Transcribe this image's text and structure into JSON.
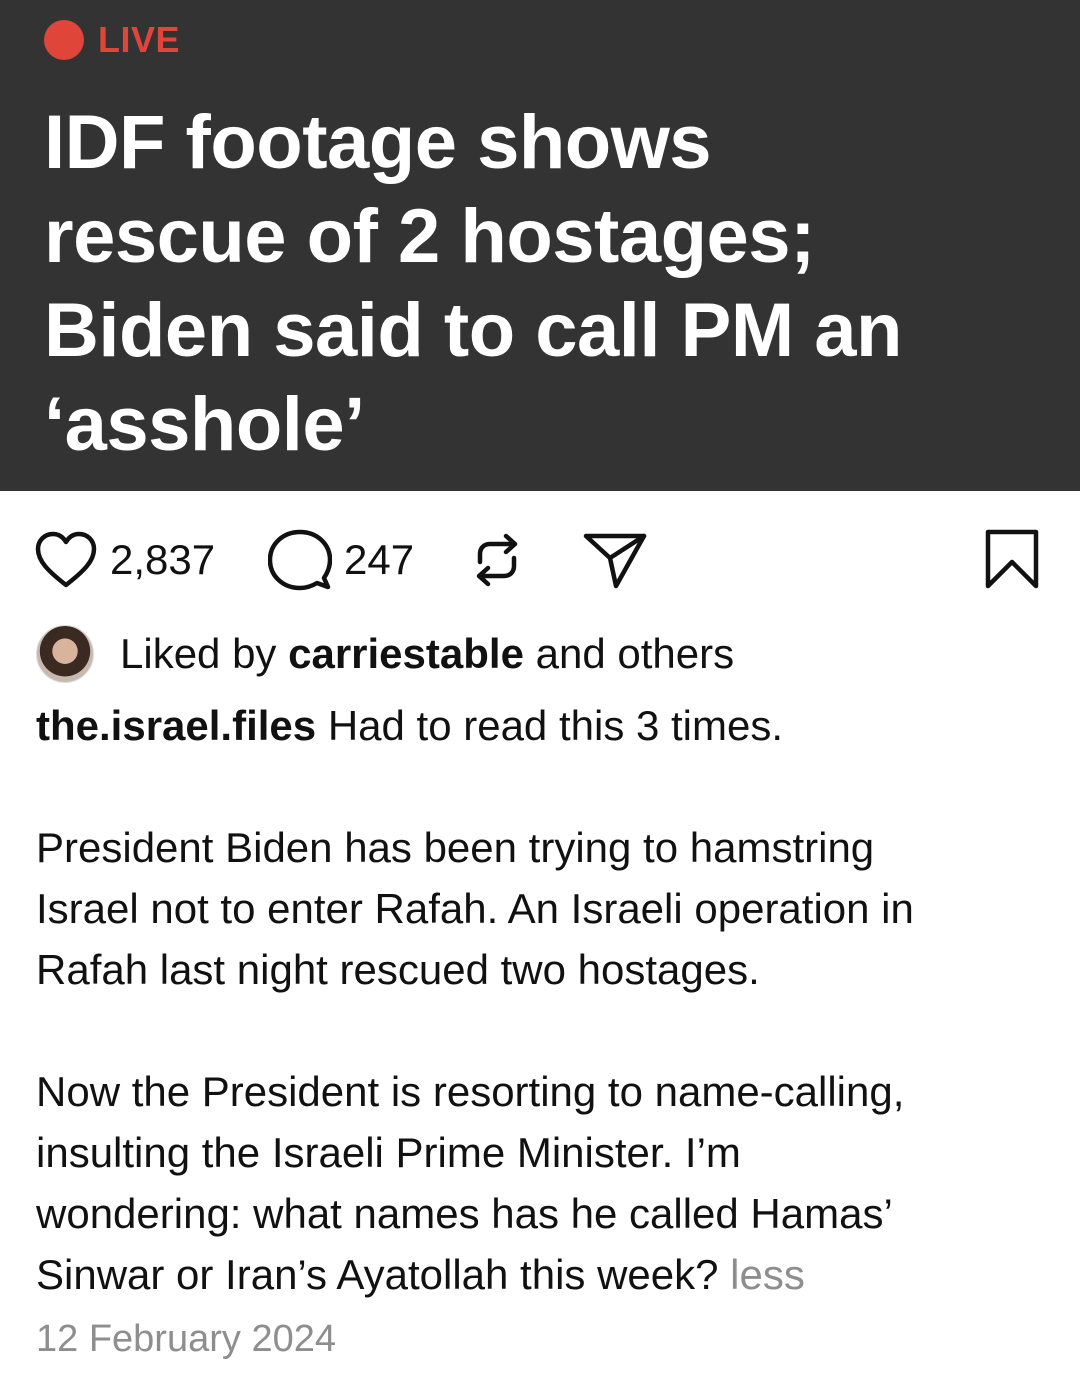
{
  "hero": {
    "live_label": "LIVE",
    "headline_lines": [
      "IDF footage shows",
      "rescue of 2 hostages;",
      "Biden said to call PM an",
      "‘asshole’"
    ],
    "background": "#333333",
    "live_color": "#e0453a"
  },
  "actions": {
    "like_count": "2,837",
    "comment_count": "247",
    "icons": [
      "heart-icon",
      "comment-icon",
      "repost-icon",
      "share-icon",
      "bookmark-icon"
    ]
  },
  "likes": {
    "prefix": "Liked by",
    "user": "carriestable",
    "suffix": "and others"
  },
  "caption": {
    "username": "the.israel.files",
    "line1": "Had to read this 3 times.",
    "para2": [
      "President Biden has been trying to hamstring",
      "Israel not to enter Rafah. An Israeli operation in",
      "Rafah last night rescued two hostages."
    ],
    "para3": [
      "Now the President is resorting to name-calling,",
      "insulting the Israeli Prime Minister. I’m",
      "wondering: what names has he called Hamas’",
      "Sinwar or Iran’s Ayatollah this week?"
    ],
    "less_label": "less"
  },
  "date": "12 February 2024"
}
